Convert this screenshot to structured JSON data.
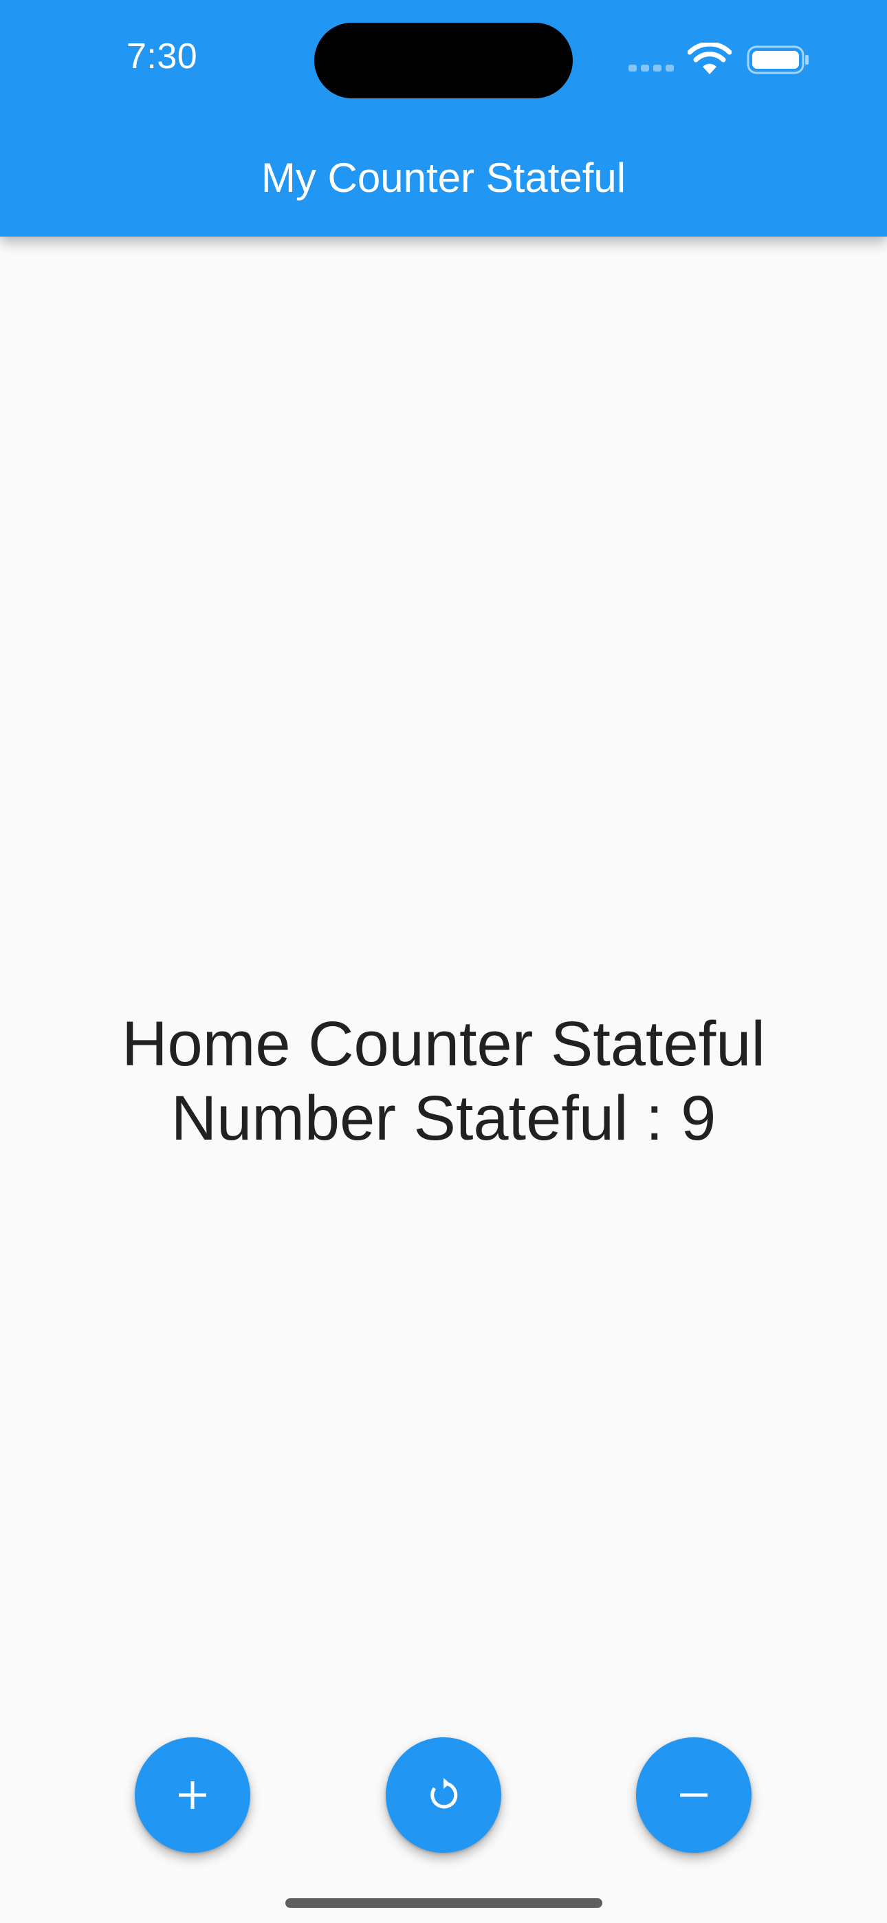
{
  "status_bar": {
    "time": "7:30",
    "signal_icon": "cellular-signal-icon",
    "wifi_icon": "wifi-icon",
    "battery_icon": "battery-icon"
  },
  "app_bar": {
    "title": "My Counter Stateful",
    "color": "#2196f3"
  },
  "main": {
    "heading": "Home Counter Stateful",
    "counter_label": "Number Stateful : 9"
  },
  "actions": [
    {
      "icon": "add-icon"
    },
    {
      "icon": "refresh-icon"
    },
    {
      "icon": "remove-icon"
    }
  ],
  "colors": {
    "accent": "#2196f3",
    "background": "#fafafa",
    "text": "#212121"
  }
}
